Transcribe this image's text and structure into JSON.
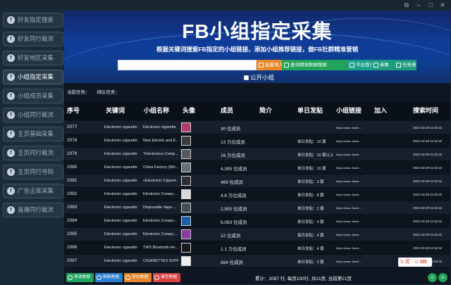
{
  "window": {
    "controls": [
      "⧉",
      "–",
      "□",
      "✕"
    ]
  },
  "sidebar": {
    "items": [
      {
        "label": "好友指定搜索",
        "icon": "f"
      },
      {
        "label": "好友同行截流",
        "icon": "f"
      },
      {
        "label": "好友地区采集",
        "icon": "f"
      },
      {
        "label": "小组指定采集",
        "icon": "f",
        "active": true
      },
      {
        "label": "小组成员采集",
        "icon": "f"
      },
      {
        "label": "小组同行截流",
        "icon": "f"
      },
      {
        "label": "主页基础采集",
        "icon": "f"
      },
      {
        "label": "主页同行截流",
        "icon": "f"
      },
      {
        "label": "主页同行号码",
        "icon": "f"
      },
      {
        "label": "广告企库采集",
        "icon": "f"
      },
      {
        "label": "直播同行截流",
        "icon": "f"
      }
    ]
  },
  "banner": {
    "title": "FB小组指定采集",
    "subtitle": "根据关键词搜索FB指定的小组链接，添加小组推荐链接，做FB社群精准营销"
  },
  "search": {
    "value": "",
    "buttons": {
      "import": "批量导入",
      "query": "查询精准数据搜索",
      "login": "平台登录",
      "params": "参数",
      "tasks": "任务表"
    },
    "public_group_label": "公开小组"
  },
  "status": {
    "current_task": "当前任务：",
    "queued_task": "排队任务："
  },
  "table": {
    "headers": [
      "序号",
      "关键词",
      "小组名称",
      "头像",
      "成员",
      "简介",
      "单日发贴",
      "小组链接",
      "加入",
      "搜索时间"
    ],
    "rows": [
      {
        "idx": "2077",
        "keyword": "Electronic cigarette",
        "name": "Electronic cigarette",
        "members": "30 位成员",
        "post": "",
        "link": "https://www. faceb...",
        "time": "2022-10-29 11:52:42",
        "avatar_color": "#b0406a"
      },
      {
        "idx": "2078",
        "keyword": "Electronic cigarette",
        "name": "New Electric and E...",
        "members": "13 万位成员",
        "post": "单日发贴：10 篇",
        "link": "https://www. faceb...",
        "time": "2022-10-29 11:52:42",
        "avatar_color": "#3c3c3c"
      },
      {
        "idx": "2079",
        "keyword": "Electronic cigarette",
        "name": "\"Electronics Comp...",
        "members": "16 万位成员",
        "post": "单日发贴：10 篇以上",
        "link": "https://www. faceb...",
        "time": "2022-10-29 11:52:42",
        "avatar_color": "#5a5a5a"
      },
      {
        "idx": "2080",
        "keyword": "Electronic cigarette",
        "name": "China Factory (Wh...",
        "members": "4,395 位成员",
        "post": "单日发贴：10 篇",
        "link": "https://www. faceb...",
        "time": "2022-10-29 11:52:42",
        "avatar_color": "#6a7078"
      },
      {
        "idx": "2081",
        "keyword": "Electronic cigarette",
        "name": "«Electronic Cigaret...",
        "members": "469 位成员",
        "post": "单日发贴：3 篇",
        "link": "https://www. faceb...",
        "time": "2022-10-29 11:52:42",
        "avatar_color": "#2e2e36"
      },
      {
        "idx": "2082",
        "keyword": "Electronic cigarette",
        "name": "Electronic Compo...",
        "members": "4.6 万位成员",
        "post": "单日发贴：8 篇",
        "link": "https://www. faceb...",
        "time": "2022-10-29 11:52:42",
        "avatar_color": "#d8d8d8"
      },
      {
        "idx": "2083",
        "keyword": "Electronic cigarette",
        "name": "Disposable Vape ...",
        "members": "2,955 位成员",
        "post": "单日发贴：2 篇",
        "link": "https://www. faceb...",
        "time": "2022-10-29 11:52:42",
        "avatar_color": "#4a4a52"
      },
      {
        "idx": "2084",
        "keyword": "Electronic cigarette",
        "name": "Electronic Compo...",
        "members": "6,083 位成员",
        "post": "单日发贴：4 篇",
        "link": "https://www. faceb...",
        "time": "2022-10-29 11:52:42",
        "avatar_color": "#1f5fa8"
      },
      {
        "idx": "2085",
        "keyword": "Electronic cigarette",
        "name": "Electronic Compo...",
        "members": "12 位成员",
        "post": "每月发贴：4 篇",
        "link": "https://www. faceb...",
        "time": "2022-10-29 11:52:42",
        "avatar_color": "#8a3aa0"
      },
      {
        "idx": "2086",
        "keyword": "Electronic cigarette",
        "name": "TWS Bluetooth He...",
        "members": "1.1 万位成员",
        "post": "单日发贴：4 篇",
        "link": "https://www. faceb...",
        "time": "2022-10-29 11:52:42",
        "avatar_color": "#1a1a1a"
      },
      {
        "idx": "2087",
        "keyword": "Electronic cigarette",
        "name": "CIGARETTES SUPPLI...",
        "members": "664 位成员",
        "post": "单日发贴：2 篇",
        "link": "https://www. faceb...",
        "time": "2022-10-29 11:52:42",
        "avatar_color": "#eeeeee"
      }
    ]
  },
  "footer": {
    "buttons": {
      "filter": "筛选数据",
      "refresh": "刷新数据",
      "export": "导出数据",
      "clear": "清空数据"
    },
    "pagination": "累计：2087 行, 每页100行, 共21页, 当前第21页",
    "prev": "<",
    "next": ">"
  },
  "ime": {
    "label": "S 英 · ⊙ ⌨"
  }
}
